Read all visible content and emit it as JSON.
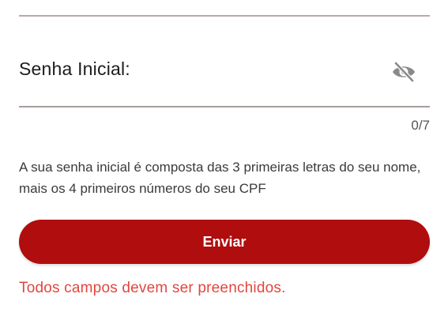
{
  "password_field": {
    "label": "Senha Inicial:",
    "value": "",
    "placeholder": "",
    "visibility_icon": "eye-slash-icon",
    "counter": "0/7"
  },
  "hint": {
    "text": "A sua senha inicial é composta das 3 primeiras letras do seu nome, mais os 4 primeiros números do seu CPF"
  },
  "submit": {
    "label": "Enviar"
  },
  "validation": {
    "error_text": "Todos campos devem ser preenchidos."
  },
  "colors": {
    "primary": "#b00d0f",
    "error": "#e2463f",
    "icon": "#8a8a8a"
  }
}
